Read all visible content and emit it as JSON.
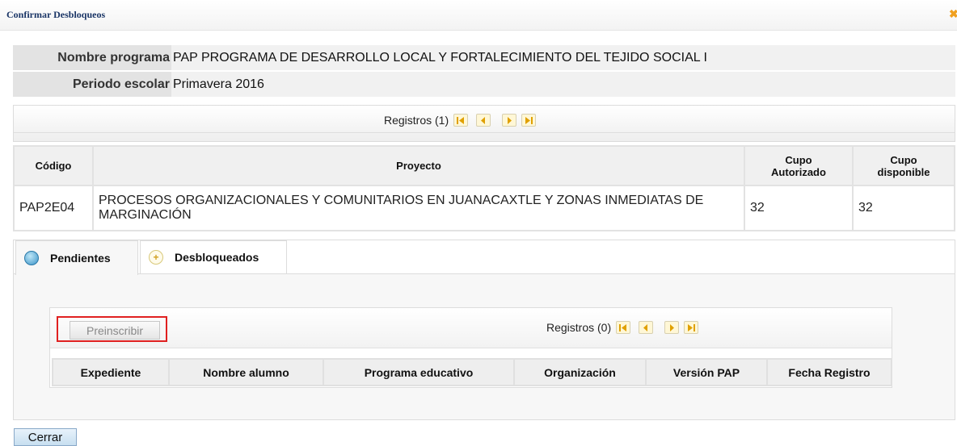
{
  "dialog": {
    "title": "Confirmar Desbloqueos",
    "close_icon": "close-icon"
  },
  "info": {
    "programa_label": "Nombre programa",
    "programa_value": "PAP PROGRAMA DE DESARROLLO LOCAL Y FORTALECIMIENTO DEL TEJIDO SOCIAL I",
    "periodo_label": "Periodo escolar",
    "periodo_value": "Primavera 2016"
  },
  "pager_top": {
    "text": "Registros (1)"
  },
  "project_table": {
    "headers": [
      "Código",
      "Proyecto",
      "Cupo Autorizado",
      "Cupo disponible"
    ],
    "rows": [
      {
        "codigo": "PAP2E04",
        "proyecto": "PROCESOS ORGANIZACIONALES Y COMUNITARIOS EN JUANACAXTLE Y ZONAS INMEDIATAS DE MARGINACIÓN",
        "cupo_autorizado": "32",
        "cupo_disponible": "32"
      }
    ]
  },
  "tabs": [
    {
      "label": "Pendientes",
      "active": true
    },
    {
      "label": "Desbloqueados",
      "active": false
    }
  ],
  "grid": {
    "preinscribir_label": "Preinscribir",
    "pager_text": "Registros (0)",
    "headers": [
      "Expediente",
      "Nombre alumno",
      "Programa educativo",
      "Organización",
      "Versión PAP",
      "Fecha Registro"
    ]
  },
  "footer": {
    "cerrar_label": "Cerrar"
  },
  "colors": {
    "title": "#1a3566",
    "highlight": "#e02020",
    "pager_button": "#fff7d6"
  }
}
